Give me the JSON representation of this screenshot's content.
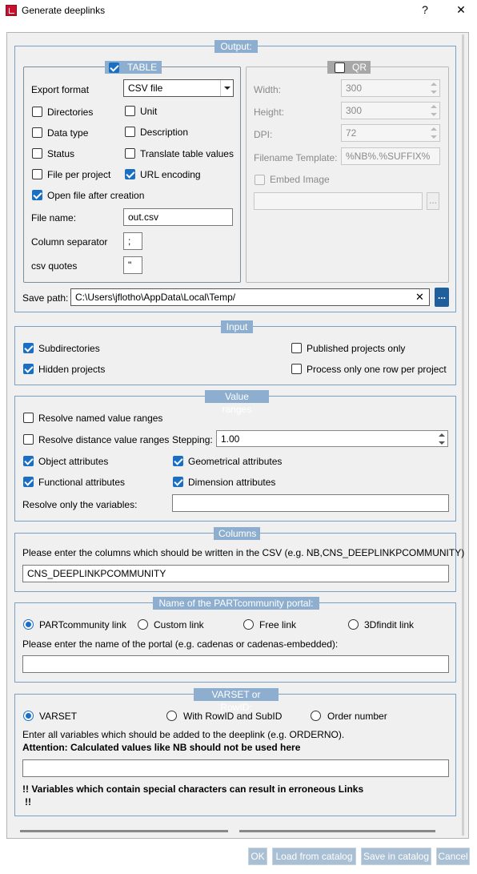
{
  "window": {
    "title": "Generate deeplinks",
    "help": "?",
    "close": "✕"
  },
  "output": {
    "title": "Output:",
    "table": {
      "title": "TABLE",
      "checked": true,
      "export_format_label": "Export format",
      "export_format_value": "CSV file",
      "directories": "Directories",
      "unit": "Unit",
      "data_type": "Data type",
      "description": "Description",
      "status": "Status",
      "translate": "Translate table values",
      "file_per_project": "File per project",
      "url_encoding": "URL encoding",
      "open_file": "Open file after creation",
      "file_name_label": "File name:",
      "file_name_value": "out.csv",
      "col_sep_label": "Column separator",
      "col_sep_value": ";",
      "csv_quotes_label": "csv quotes",
      "csv_quotes_value": "\""
    },
    "qr": {
      "title": "QR",
      "checked": false,
      "width_label": "Width:",
      "width_value": "300",
      "height_label": "Height:",
      "height_value": "300",
      "dpi_label": "DPI:",
      "dpi_value": "72",
      "template_label": "Filename Template:",
      "template_value": "%NB%.%SUFFIX%",
      "embed_label": "Embed Image",
      "browse": "..."
    },
    "save_path_label": "Save path:",
    "save_path_value": "C:\\Users\\jflotho\\AppData\\Local\\Temp/",
    "clear": "✕",
    "browse": "..."
  },
  "input": {
    "title": "Input",
    "subdirectories": "Subdirectories",
    "hidden_projects": "Hidden projects",
    "published_only": "Published projects only",
    "one_row": "Process only one row per project"
  },
  "value_ranges": {
    "title": "Value ranges",
    "resolve_named": "Resolve named value ranges",
    "resolve_distance": "Resolve distance value ranges",
    "stepping_label": "Stepping:",
    "stepping_value": "1.00",
    "object_attr": "Object attributes",
    "geometrical_attr": "Geometrical attributes",
    "functional_attr": "Functional attributes",
    "dimension_attr": "Dimension attributes",
    "resolve_vars_label": "Resolve only the variables:",
    "resolve_vars_value": ""
  },
  "columns": {
    "title": "Columns",
    "hint": "Please enter the columns which should be written in the CSV (e.g. NB,CNS_DEEPLINKPCOMMUNITY)",
    "value": "CNS_DEEPLINKPCOMMUNITY"
  },
  "portal": {
    "title": "Name of the PARTcommunity portal:",
    "opt1": "PARTcommunity link",
    "opt2": "Custom link",
    "opt3": "Free link",
    "opt4": "3Dfindit link",
    "hint": "Please enter the name of the portal (e.g. cadenas or cadenas-embedded):",
    "value": ""
  },
  "varset": {
    "title": "VARSET or RowID:",
    "opt1": "VARSET",
    "opt2": "With RowID and SubID",
    "opt3": "Order number",
    "hint": "Enter all variables which should be added to the deeplink (e.g. ORDERNO).",
    "attention": "Attention: Calculated values like NB should not be used here",
    "value": "",
    "warning": "!! Variables which contain special characters can result in erroneous Links",
    "warning2": "!!"
  },
  "buttons": {
    "ok": "OK",
    "load": "Load from catalog",
    "save": "Save in catalog",
    "cancel": "Cancel"
  },
  "colors": {
    "group_border": "#7aa0c4",
    "group_title_bg": "#8daecf",
    "checkbox_on": "#1a6fc4",
    "button_bg": "#a9bfd3"
  }
}
